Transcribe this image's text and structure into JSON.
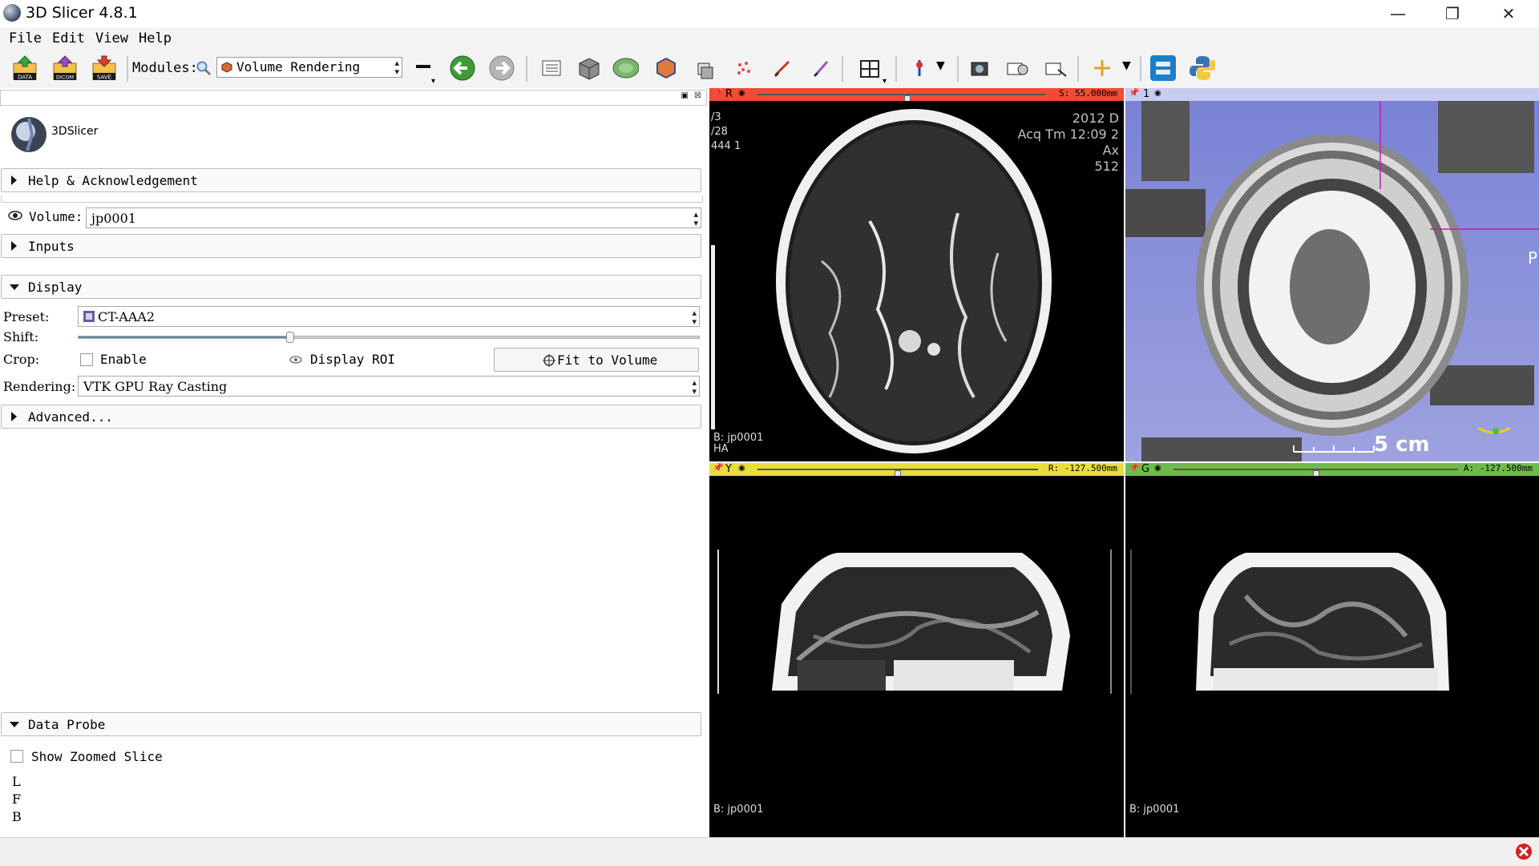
{
  "window": {
    "title": "3D Slicer 4.8.1",
    "minimize_glyph": "—",
    "restore_glyph": "❐",
    "close_glyph": "✕"
  },
  "menu": [
    "File",
    "Edit",
    "View",
    "Help"
  ],
  "toolbar": {
    "data_label": "DATA",
    "dicom_label": "DICOM",
    "save_label": "SAVE",
    "modules_label": "Modules:",
    "module_selected": "Volume Rendering"
  },
  "panel": {
    "logo_text": "3DSlicer",
    "help_section": "Help & Acknowledgement",
    "volume_label": "Volume:",
    "volume_value": "jp0001",
    "inputs_section": "Inputs",
    "display_section": "Display",
    "preset_label": "Preset:",
    "preset_value": "CT-AAA2",
    "shift_label": "Shift:",
    "shift_fraction": 0.34,
    "crop_label": "Crop:",
    "enable_label": "Enable",
    "display_roi_label": "Display ROI",
    "fit_button": "Fit to Volume",
    "rendering_label": "Rendering:",
    "rendering_value": "VTK GPU Ray Casting",
    "advanced_section": "Advanced...",
    "data_probe_section": "Data Probe",
    "show_zoomed_label": "Show Zoomed Slice",
    "probe_lines": [
      "L",
      "F",
      "B"
    ]
  },
  "views": {
    "red": {
      "letter": "R",
      "value": "S: 55.000mm",
      "color": "#f34a33",
      "slider_fraction": 0.52,
      "overlay_tl": [
        "/3",
        "/28",
        "444 1"
      ],
      "overlay_tr": [
        "2012 D",
        "Acq Tm  12:09 2",
        "Ax",
        "512"
      ],
      "overlay_bl": [
        "B: jp0001",
        "HA"
      ]
    },
    "threed": {
      "label": "1",
      "color": "#7e86d8",
      "scale_label": "5 cm",
      "orientation": "P"
    },
    "yellow": {
      "letter": "Y",
      "value": "R: -127.500mm",
      "color": "#e8dd3c",
      "slider_fraction": 0.5,
      "overlay_bl": "B: jp0001"
    },
    "green": {
      "letter": "G",
      "value": "A: -127.500mm",
      "color": "#6dbc4a",
      "slider_fraction": 0.5,
      "overlay_bl": "B: jp0001"
    }
  }
}
